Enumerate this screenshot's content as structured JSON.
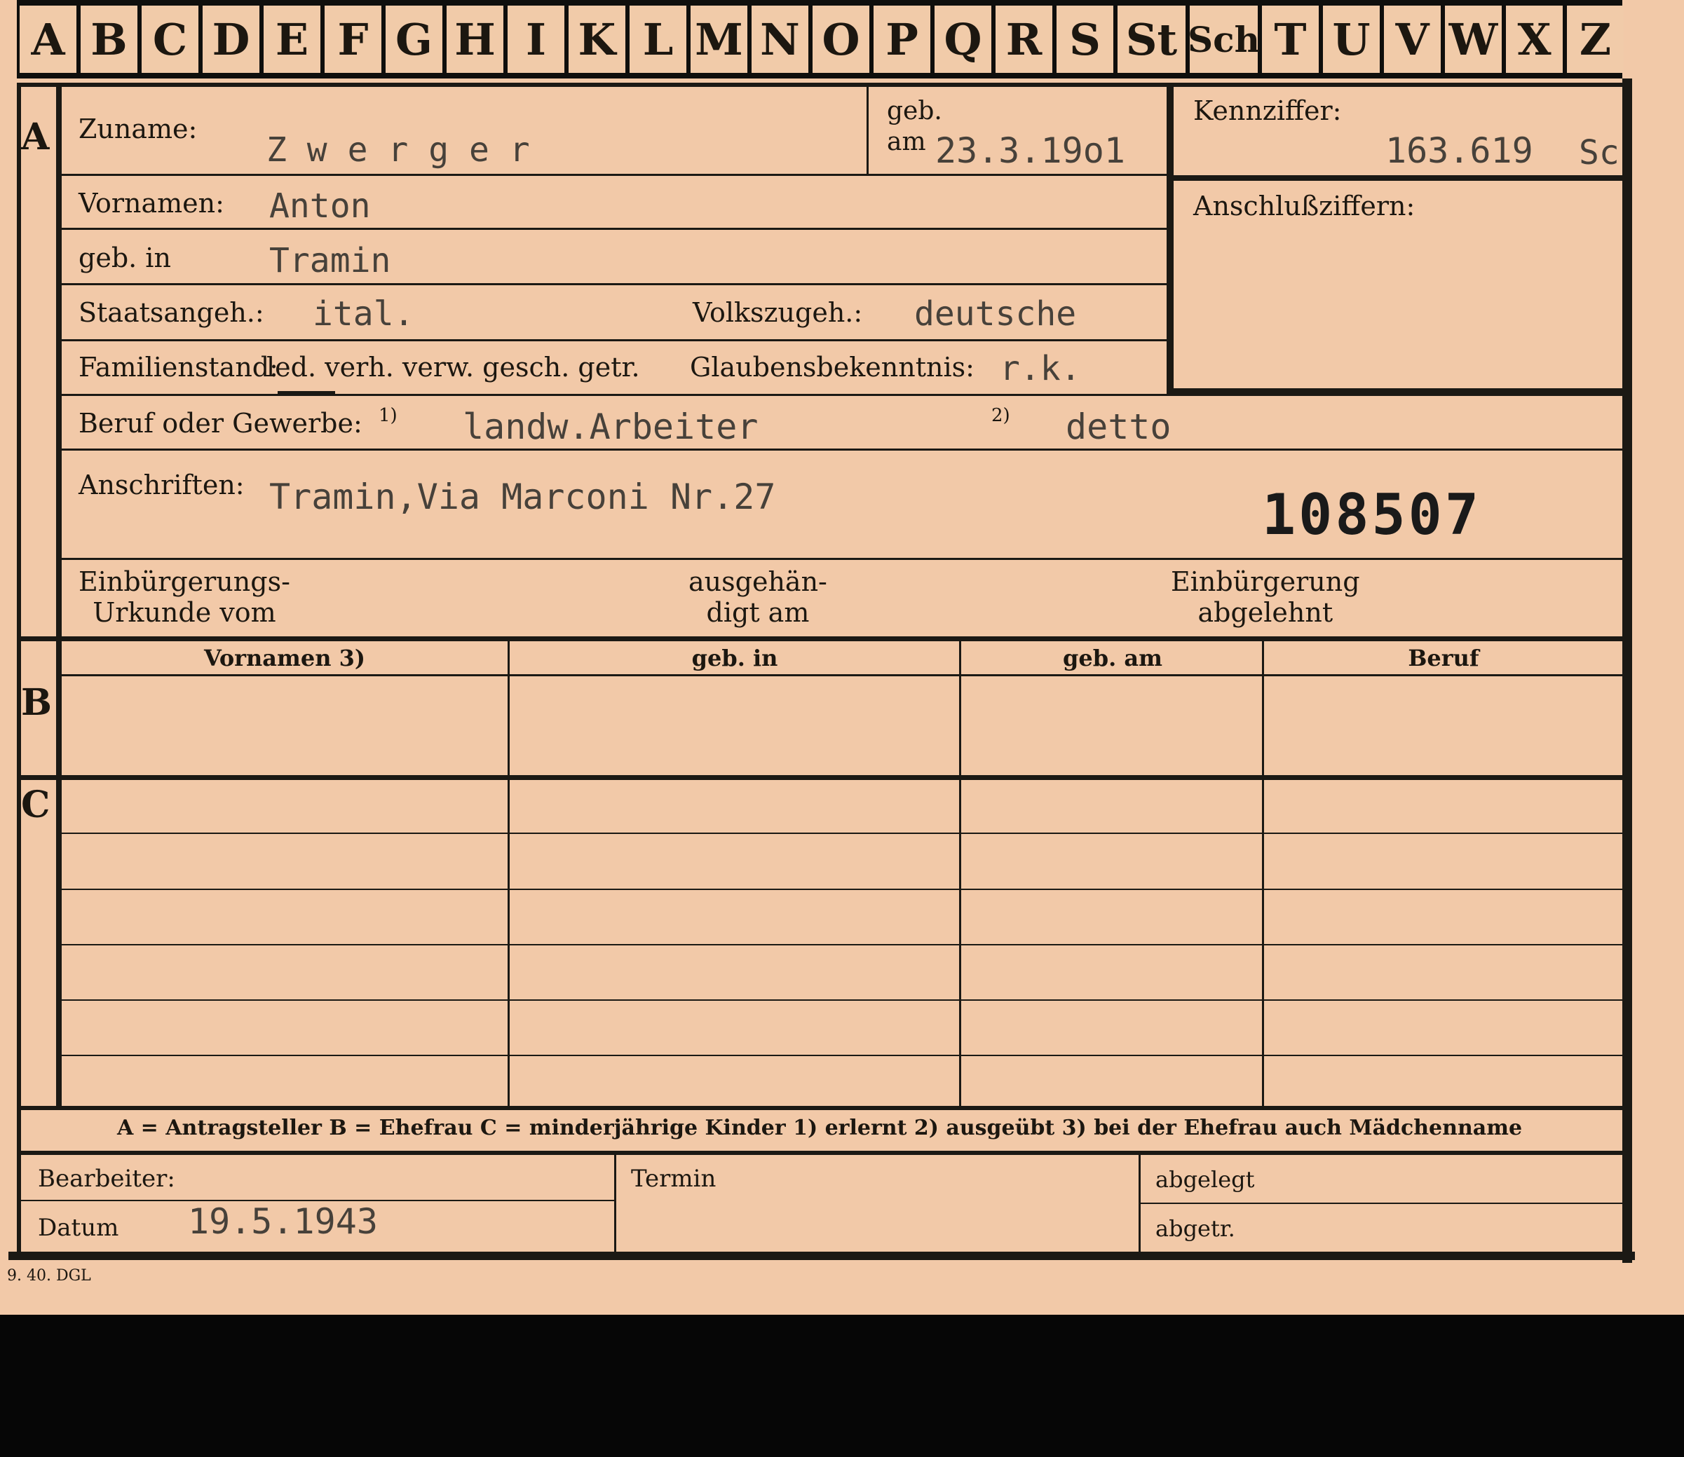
{
  "tabs": [
    "A",
    "B",
    "C",
    "D",
    "E",
    "F",
    "G",
    "H",
    "I",
    "K",
    "L",
    "M",
    "N",
    "O",
    "P",
    "Q",
    "R",
    "S",
    "St",
    "Sch",
    "T",
    "U",
    "V",
    "W",
    "X",
    "Z"
  ],
  "section_a": {
    "letter": "A",
    "zuname_label": "Zuname:",
    "zuname_value": "Z w e r g e r",
    "geb_label": "geb.",
    "am_label": "am",
    "geb_am_value": "23.3.19o1",
    "kennziffer_label": "Kennziffer:",
    "kennziffer_value": "163.619",
    "kennziffer_suffix": "Sc",
    "anschluss_label": "Anschlußziffern:",
    "vornamen_label": "Vornamen:",
    "vornamen_value": "Anton",
    "geb_in_label": "geb. in",
    "geb_in_value": "Tramin",
    "staats_label": "Staatsangeh.:",
    "staats_value": "ital.",
    "volks_label": "Volkszugeh.:",
    "volks_value": "deutsche",
    "familien_label": "Familienstand:",
    "familien_options": "led. verh. verw. gesch. getr.",
    "glaube_label": "Glaubensbekenntnis:",
    "glaube_value": "r.k.",
    "beruf_label": "Beruf oder Gewerbe:",
    "beruf_fn1": "1)",
    "beruf_value1": "landw.Arbeiter",
    "beruf_fn2": "2)",
    "beruf_value2": "detto",
    "anschriften_label": "Anschriften:",
    "anschriften_value": "Tramin,Via Marconi Nr.27",
    "stamp_number": "108507",
    "einb_urkunde_label": "Einbürgerungs-\nUrkunde vom",
    "ausgehaend_label": "ausgehän-\ndigt am",
    "einb_abgelehnt_label": "Einbürgerung\nabgelehnt"
  },
  "section_b": {
    "letter": "B",
    "col_vornamen": "Vornamen 3)",
    "col_geb_in": "geb. in",
    "col_geb_am": "geb. am",
    "col_beruf": "Beruf"
  },
  "section_c": {
    "letter": "C"
  },
  "legend": "A = Antragsteller   B = Ehefrau   C = minderjährige Kinder   1) erlernt   2) ausgeübt   3) bei der Ehefrau auch Mädchenname",
  "footer": {
    "bearbeiter_label": "Bearbeiter:",
    "datum_label": "Datum",
    "datum_value": "19.5.1943",
    "termin_label": "Termin",
    "abgelegt_label": "abgelegt",
    "abgetr_label": "abgetr."
  },
  "print_code": "9. 40. DGL",
  "colors": {
    "card": "#f2c9a8",
    "ink": "#1c1710",
    "typed": "#47413a",
    "background": "#060606"
  }
}
